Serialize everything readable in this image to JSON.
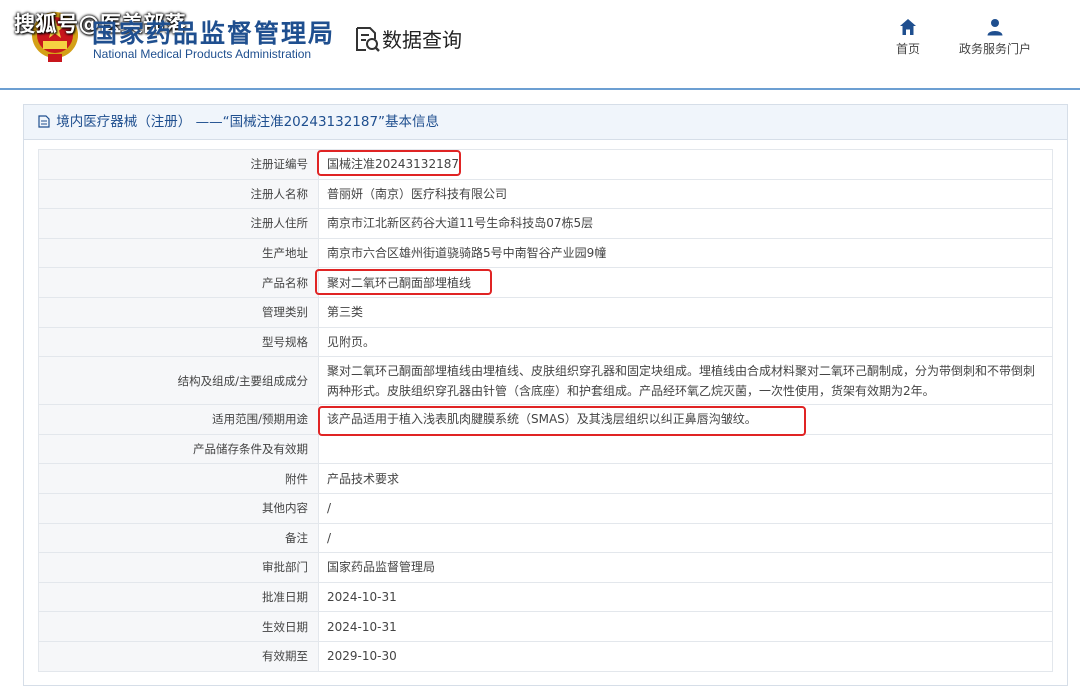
{
  "watermark": "搜狐号@医美部落",
  "header": {
    "org_name_cn": "国家药品监督管理局",
    "org_name_en": "National Medical Products Administration",
    "query_label": "数据查询",
    "nav": {
      "home": "首页",
      "portal": "政务服务门户"
    }
  },
  "panel": {
    "title": "境内医疗器械（注册） ——“国械注准20243132187”基本信息"
  },
  "rows": [
    {
      "label": "注册证编号",
      "value": "国械注准20243132187"
    },
    {
      "label": "注册人名称",
      "value": "普丽妍（南京）医疗科技有限公司"
    },
    {
      "label": "注册人住所",
      "value": "南京市江北新区药谷大道11号生命科技岛07栋5层"
    },
    {
      "label": "生产地址",
      "value": "南京市六合区雄州街道骁骑路5号中南智谷产业园9幢"
    },
    {
      "label": "产品名称",
      "value": "聚对二氧环己酮面部埋植线"
    },
    {
      "label": "管理类别",
      "value": "第三类"
    },
    {
      "label": "型号规格",
      "value": "见附页。"
    },
    {
      "label": "结构及组成/主要组成成分",
      "value": "聚对二氧环己酮面部埋植线由埋植线、皮肤组织穿孔器和固定块组成。埋植线由合成材料聚对二氧环己酮制成，分为带倒刺和不带倒刺两种形式。皮肤组织穿孔器由针管（含底座）和护套组成。产品经环氧乙烷灭菌，一次性使用，货架有效期为2年。"
    },
    {
      "label": "适用范围/预期用途",
      "value": "该产品适用于植入浅表肌肉腱膜系统（SMAS）及其浅层组织以纠正鼻唇沟皱纹。"
    },
    {
      "label": "产品储存条件及有效期",
      "value": ""
    },
    {
      "label": "附件",
      "value": "产品技术要求"
    },
    {
      "label": "其他内容",
      "value": "/"
    },
    {
      "label": "备注",
      "value": "/"
    },
    {
      "label": "审批部门",
      "value": "国家药品监督管理局"
    },
    {
      "label": "批准日期",
      "value": "2024-10-31"
    },
    {
      "label": "生效日期",
      "value": "2024-10-31"
    },
    {
      "label": "有效期至",
      "value": "2029-10-30"
    }
  ],
  "colors": {
    "brand_blue": "#1f4f8f",
    "highlight_red": "#e02424",
    "header_rule": "#6c9fd2"
  }
}
